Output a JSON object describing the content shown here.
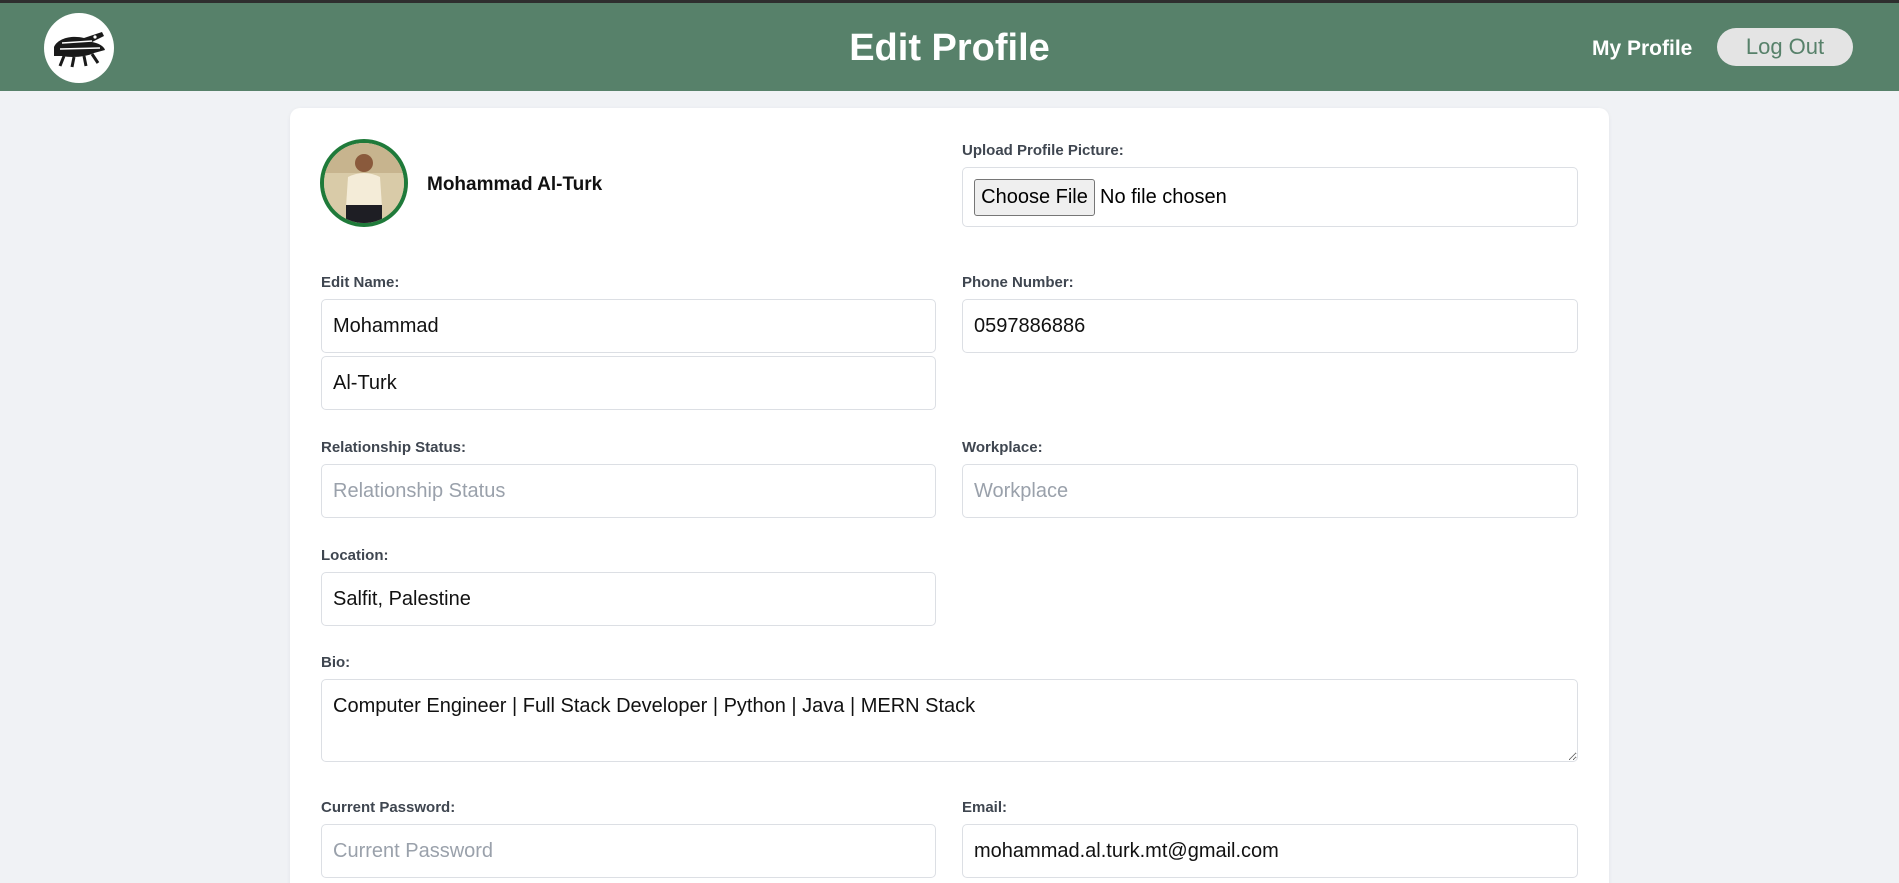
{
  "header": {
    "title": "Edit Profile",
    "nav_my_profile": "My Profile",
    "logout_label": "Log Out",
    "logo_icon": "crocodile-icon",
    "background_color": "#57816a"
  },
  "profile": {
    "display_name": "Mohammad Al-Turk",
    "avatar_border_color": "#1f7a3a"
  },
  "upload": {
    "label": "Upload Profile Picture:",
    "button_label": "Choose File",
    "status": "No file chosen"
  },
  "fields": {
    "name_label": "Edit Name:",
    "first_name": "Mohammad",
    "last_name": "Al-Turk",
    "phone_label": "Phone Number:",
    "phone": "0597886886",
    "relationship_label": "Relationship Status:",
    "relationship_placeholder": "Relationship Status",
    "workplace_label": "Workplace:",
    "workplace_placeholder": "Workplace",
    "location_label": "Location:",
    "location": "Salfit, Palestine",
    "bio_label": "Bio:",
    "bio": "Computer Engineer | Full Stack Developer | Python | Java | MERN Stack",
    "current_password_label": "Current Password:",
    "current_password_placeholder": "Current Password",
    "email_label": "Email:",
    "email": "mohammad.al.turk.mt@gmail.com"
  }
}
